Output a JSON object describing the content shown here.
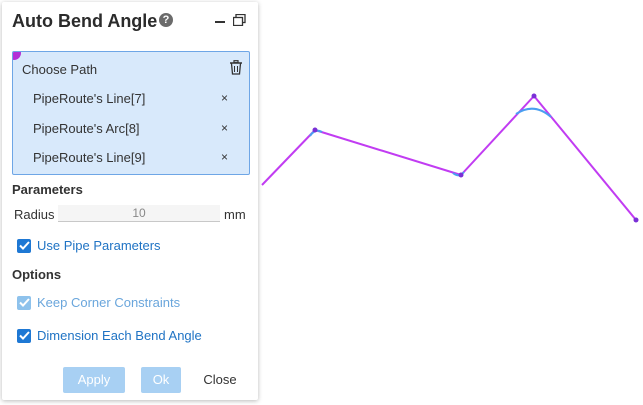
{
  "panel": {
    "title": "Auto Bend Angle",
    "help_icon": "question-circle-icon",
    "help_glyph": "?",
    "minimize_icon": "minimize-icon",
    "restore_icon": "restore-window-icon"
  },
  "choose_path": {
    "header": "Choose Path",
    "delete_icon": "trash-icon",
    "items": [
      {
        "label": "PipeRoute's Line[7]",
        "remove_glyph": "×"
      },
      {
        "label": "PipeRoute's Arc[8]",
        "remove_glyph": "×"
      },
      {
        "label": "PipeRoute's Line[9]",
        "remove_glyph": "×"
      }
    ]
  },
  "parameters": {
    "title": "Parameters",
    "radius_label": "Radius",
    "radius_value": "10",
    "unit": "mm",
    "use_pipe_parameters": {
      "label": "Use Pipe Parameters",
      "checked": true
    }
  },
  "options": {
    "title": "Options",
    "keep_corner_constraints": {
      "label": "Keep Corner Constraints",
      "checked": true,
      "disabled": true
    },
    "dimension_each_bend_angle": {
      "label": "Dimension Each Bend Angle",
      "checked": true
    }
  },
  "buttons": {
    "apply": "Apply",
    "ok": "Ok",
    "close": "Close"
  },
  "colors": {
    "accent": "#1e78d4",
    "path_line": "#c13cf2",
    "bend_arc": "#4a9ff0",
    "selection_bg": "#d8e9fb"
  }
}
